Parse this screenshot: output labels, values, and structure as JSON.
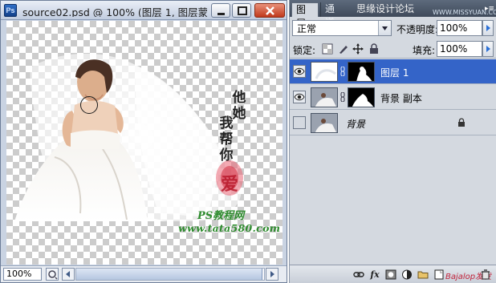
{
  "app": "Photoshop",
  "document": {
    "logo": "Ps",
    "title": "source02.psd @ 100% (图层 1, 图层蒙",
    "zoom": "100%",
    "hscroll_fraction": 0.99,
    "artwork": {
      "calligraphy_col1": "他她",
      "calligraphy_col2": "我帮你",
      "seal": "爱",
      "ps_tutorial": "PS教程网",
      "url": "www.tata580.com"
    }
  },
  "panel": {
    "tabs": [
      "图层",
      "通道"
    ],
    "watermark_tab": "思缘设计论坛",
    "watermark_url": "WWW.MISSYUAN.COM",
    "blend_mode": "正常",
    "opacity_label": "不透明度:",
    "opacity_value": "100%",
    "lock_label": "锁定:",
    "fill_label": "填充:",
    "fill_value": "100%",
    "layers": [
      {
        "name": "图层 1",
        "visible": true,
        "selected": true,
        "has_mask": true
      },
      {
        "name": "背景 副本",
        "visible": true,
        "selected": false,
        "has_mask": true
      },
      {
        "name": "背景",
        "visible": false,
        "selected": false,
        "has_mask": false,
        "locked": true
      }
    ],
    "footer_watermark": "Bajalop发发"
  },
  "icons": [
    "ps-logo-icon",
    "minimize-icon",
    "maximize-icon",
    "close-icon",
    "eye-icon",
    "chain-link-icon",
    "lock-icon",
    "fx-icon",
    "mask-icon",
    "adjustment-icon",
    "folder-icon",
    "new-layer-icon",
    "trash-icon"
  ]
}
